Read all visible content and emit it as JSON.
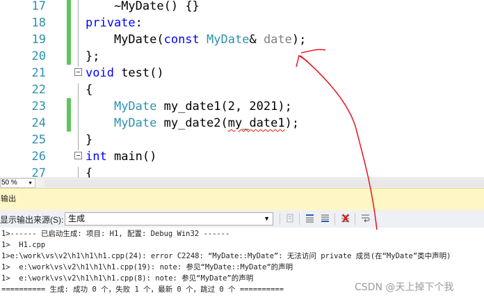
{
  "editor": {
    "lines": [
      {
        "num": "17",
        "segments": [
          {
            "t": "    ~",
            "c": ""
          },
          {
            "t": "MyDate",
            "c": ""
          },
          {
            "t": "() {}",
            "c": ""
          }
        ]
      },
      {
        "num": "18",
        "segments": [
          {
            "t": "private",
            "c": "kw"
          },
          {
            "t": ":",
            "c": ""
          }
        ]
      },
      {
        "num": "19",
        "segments": [
          {
            "t": "    MyDate(",
            "c": ""
          },
          {
            "t": "const",
            "c": "kw"
          },
          {
            "t": " ",
            "c": ""
          },
          {
            "t": "MyDate",
            "c": "ty"
          },
          {
            "t": "& ",
            "c": ""
          },
          {
            "t": "date",
            "c": "pa"
          },
          {
            "t": ");",
            "c": ""
          }
        ]
      },
      {
        "num": "20",
        "segments": [
          {
            "t": "};",
            "c": ""
          }
        ]
      },
      {
        "num": "21",
        "segments": [
          {
            "t": "void",
            "c": "kw"
          },
          {
            "t": " test()",
            "c": ""
          }
        ]
      },
      {
        "num": "22",
        "segments": [
          {
            "t": "{",
            "c": ""
          }
        ]
      },
      {
        "num": "23",
        "segments": [
          {
            "t": "    ",
            "c": ""
          },
          {
            "t": "MyDate",
            "c": "ty"
          },
          {
            "t": " my_date1(2, 2021);",
            "c": ""
          }
        ]
      },
      {
        "num": "24",
        "segments": [
          {
            "t": "    ",
            "c": ""
          },
          {
            "t": "MyDate",
            "c": "ty"
          },
          {
            "t": " my_date2(",
            "c": ""
          },
          {
            "t": "my_date1",
            "c": "squig"
          },
          {
            "t": ");",
            "c": ""
          }
        ]
      },
      {
        "num": "25",
        "segments": [
          {
            "t": "}",
            "c": ""
          }
        ]
      },
      {
        "num": "26",
        "segments": [
          {
            "t": "int",
            "c": "kw"
          },
          {
            "t": " main()",
            "c": ""
          }
        ]
      },
      {
        "num": "27",
        "segments": [
          {
            "t": "{",
            "c": ""
          }
        ]
      }
    ]
  },
  "zoom": {
    "value": "50 %"
  },
  "output": {
    "title": "输出",
    "source_label": "显示输出来源(S):",
    "source_value": "生成",
    "lines": [
      "1>------ 已启动生成: 项目: H1, 配置: Debug Win32 ------",
      "1>  H1.cpp",
      "1>e:\\work\\vs\\v2\\h1\\h1\\h1.cpp(24): error C2248: “MyDate::MyDate”: 无法访问 private 成员(在“MyDate”类中声明)",
      "1>  e:\\work\\vs\\v2\\h1\\h1\\h1.cpp(19): note: 参见“MyDate::MyDate”的声明",
      "1>  e:\\work\\vs\\v2\\h1\\h1\\h1.cpp(8): note: 参见“MyDate”的声明",
      "========== 生成: 成功 0 个，失败 1 个，最新 0 个，跳过 0 个 =========="
    ]
  },
  "watermark": "CSDN @天上掉下个我",
  "colors": {
    "keyword": "#0000ff",
    "type": "#2b91af",
    "param": "#808080",
    "change_bar": "#5cc65c",
    "annotation": "#e8101c",
    "output_title_bg": "#fff6c6"
  },
  "icons": [
    "clear-output-icon",
    "prev-message-icon",
    "next-message-icon",
    "clear-all-icon",
    "word-wrap-icon"
  ]
}
